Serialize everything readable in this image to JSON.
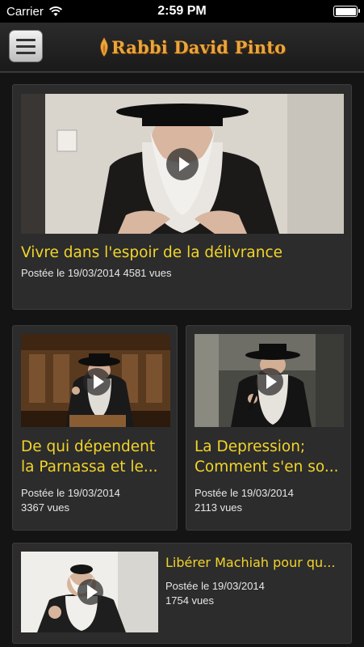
{
  "status_bar": {
    "carrier": "Carrier",
    "time": "2:59 PM",
    "battery_level": 1.0
  },
  "header": {
    "logo_text": "Rabbi David Pinto",
    "menu_icon": "hamburger-menu-icon"
  },
  "videos": [
    {
      "title": "Vivre dans l'espoir de la délivrance",
      "meta": "Postée le 19/03/2014 4581 vues"
    },
    {
      "title_line1": "De qui dépendent",
      "title_line2": "la Parnassa et le...",
      "date": "Postée le 19/03/2014",
      "views": "3367 vues"
    },
    {
      "title_line1": "La Depression;",
      "title_line2": "Comment s'en so...",
      "date": "Postée le 19/03/2014",
      "views": "2113 vues"
    },
    {
      "title": "Libérer Machiah pour qu...",
      "date": "Postée le 19/03/2014",
      "views": "1754 vues"
    }
  ],
  "colors": {
    "title_yellow": "#f2d42a",
    "logo_orange": "#e8a640",
    "card_bg": "#2c2c2c",
    "page_bg": "#141414"
  }
}
